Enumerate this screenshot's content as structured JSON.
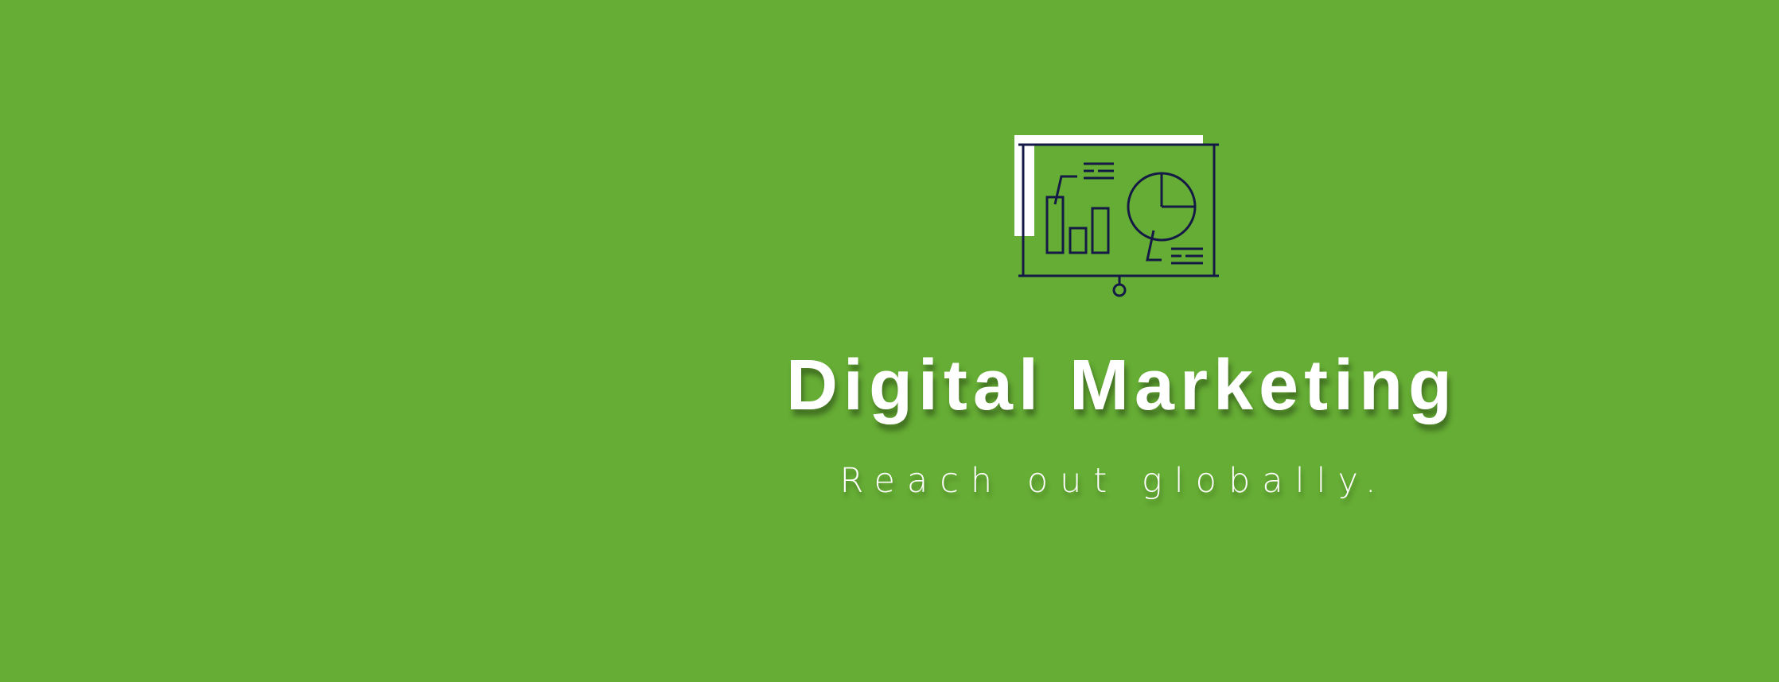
{
  "hero": {
    "title": "Digital Marketing",
    "subtitle": "Reach out globally.",
    "icon": "presentation-board-icon",
    "colors": {
      "background": "#65ad34",
      "text": "#ffffff",
      "icon_stroke": "#141a45",
      "icon_accent": "#ffffff"
    }
  }
}
